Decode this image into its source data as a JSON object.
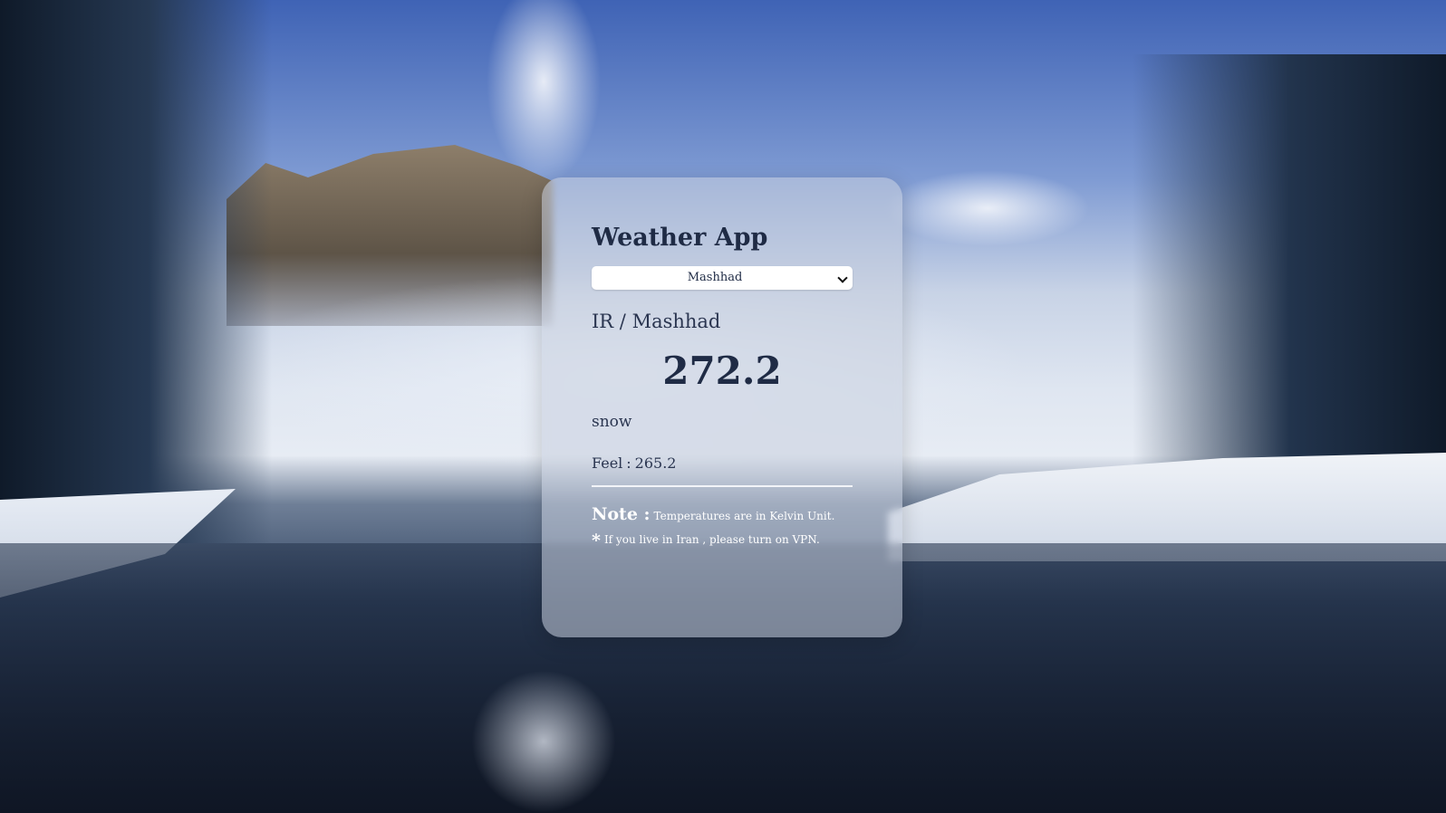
{
  "app": {
    "title": "Weather App"
  },
  "city_select": {
    "selected": "Mashhad"
  },
  "weather": {
    "country": "IR",
    "separator": "/",
    "city": "Mashhad",
    "temperature": "272.2",
    "description": "snow",
    "feel_label": "Feel",
    "feel_separator": ":",
    "feel_value": "265.2"
  },
  "notes": {
    "note_label": "Note :",
    "note_text": "Temperatures are in Kelvin Unit.",
    "star": "*",
    "vpn_text": "If you live in Iran , please turn on VPN."
  },
  "colors": {
    "title": "#1f2b45",
    "text": "#2a3550",
    "note": "#ffffff",
    "card": "rgba(200,208,222,0.55)"
  },
  "icons": {
    "select_arrow": "chevron-down-icon"
  }
}
